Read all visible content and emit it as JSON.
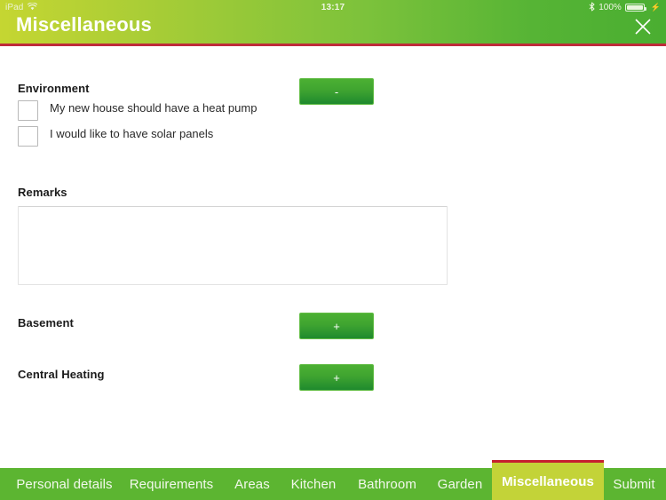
{
  "statusbar": {
    "device": "iPad",
    "wifi_icon": "wifi-icon",
    "time": "13:17",
    "bluetooth_icon": "bluetooth-icon",
    "battery_percent": "100%",
    "battery_icon": "battery-full-icon",
    "charging_icon": "charging-bolt-icon"
  },
  "header": {
    "title": "Miscellaneous",
    "close_icon": "close-icon",
    "gradient_start": "#c5d632",
    "gradient_end": "#4aae31",
    "accent_line": "#bf2b3a"
  },
  "main": {
    "sections": [
      {
        "label": "Environment",
        "button_sign": "-",
        "button_name": "environment-collapse-button"
      },
      {
        "label": "Basement",
        "button_sign": "+",
        "button_name": "basement-expand-button"
      },
      {
        "label": "Central Heating",
        "button_sign": "+",
        "button_name": "central-heating-expand-button"
      }
    ],
    "checkboxes": [
      {
        "label": "My new house should have a heat pump",
        "checked": false
      },
      {
        "label": "I would like to have solar panels",
        "checked": false
      }
    ],
    "remarks": {
      "label": "Remarks",
      "value": "",
      "placeholder": ""
    }
  },
  "nav": {
    "active_index": 6,
    "tabs": [
      {
        "label": "Personal details"
      },
      {
        "label": "Requirements"
      },
      {
        "label": "Areas"
      },
      {
        "label": "Kitchen"
      },
      {
        "label": "Bathroom"
      },
      {
        "label": "Garden"
      },
      {
        "label": "Miscellaneous"
      },
      {
        "label": "Submit"
      }
    ],
    "bar_color": "#5cb531",
    "active_color": "#c3d338",
    "active_top_line": "#c6212f"
  }
}
